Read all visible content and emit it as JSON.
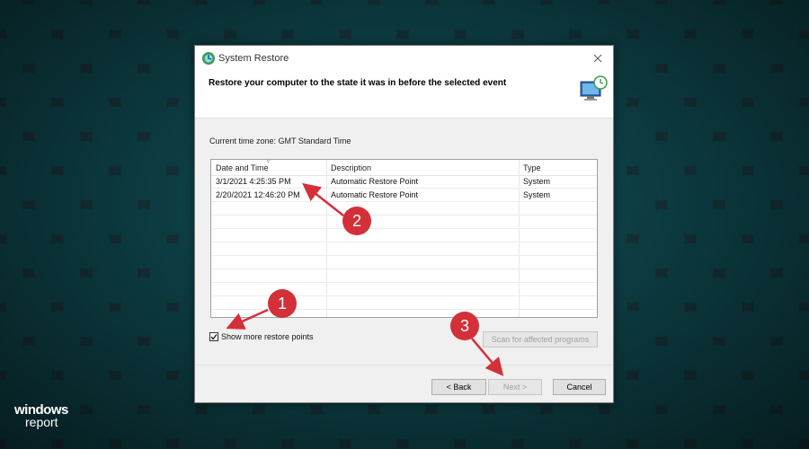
{
  "window": {
    "title": "System Restore",
    "header_text": "Restore your computer to the state it was in before the selected event",
    "timezone_label": "Current time zone: GMT Standard Time"
  },
  "table": {
    "headers": [
      "Date and Time",
      "Description",
      "Type"
    ],
    "rows": [
      [
        "3/1/2021 4:25:35 PM",
        "Automatic Restore Point",
        "System"
      ],
      [
        "2/20/2021 12:46:20 PM",
        "Automatic Restore Point",
        "System"
      ]
    ]
  },
  "checkbox": {
    "label": "Show more restore points",
    "checked": true
  },
  "buttons": {
    "scan": "Scan for affected programs",
    "back": "< Back",
    "next": "Next >",
    "cancel": "Cancel"
  },
  "annotations": [
    "1",
    "2",
    "3"
  ],
  "logo": {
    "top": "windows",
    "bottom": "report"
  },
  "colors": {
    "annotation_red": "#d3303a",
    "background": "#143036",
    "accent_pattern": "#0d4046"
  }
}
